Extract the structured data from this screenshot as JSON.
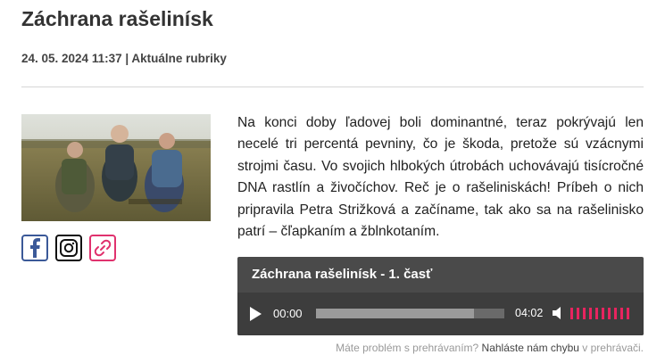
{
  "article": {
    "title": "Záchrana rašelinísk",
    "meta": "24. 05. 2024 11:37 | Aktuálne rubriky",
    "body": "Na konci doby ľadovej boli dominantné, teraz pokrývajú len necelé tri percentá pevniny, čo je škoda, pretože sú vzácnymi strojmi času. Vo svojich hlbokých útrobách uchovávajú tisícročné DNA rastlín a živočíchov. Reč je o rašeliniskách! Príbeh o nich pripravila Petra Strižková a začíname, tak ako sa na rašelinisko patrí – čľapkaním a žblnkotaním."
  },
  "socials": [
    {
      "icon": "facebook-icon",
      "color": "#3b5998"
    },
    {
      "icon": "instagram-icon",
      "color": "#111111"
    },
    {
      "icon": "link-icon",
      "color": "#e0326e"
    }
  ],
  "player": {
    "title": "Záchrana rašelinísk - 1. časť",
    "current_time": "00:00",
    "duration": "04:02",
    "buffered_fraction": 0.84,
    "volume_bars": 10,
    "accent": "#e8245f"
  },
  "report": {
    "prefix": "Máte problém s prehrávaním?",
    "link": "Nahláste nám chybu",
    "suffix": "v prehrávači."
  }
}
